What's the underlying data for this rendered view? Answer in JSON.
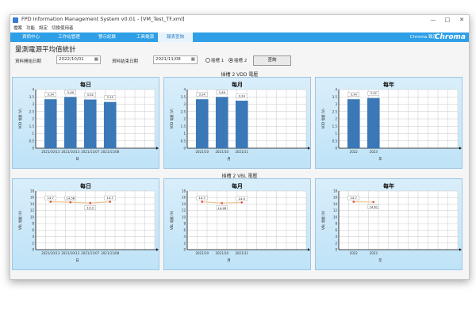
{
  "window": {
    "title": "FPD Information Management System  v0.01  -  [VM_Test_TF.xml]",
    "minimize": "—",
    "maximize": "□",
    "close": "✕"
  },
  "menu": [
    "檔案",
    "功能",
    "設定",
    "切換使用者"
  ],
  "nav": {
    "tabs": [
      "資訊中心",
      "工作站管理",
      "警示紀錄",
      "工具電源",
      "報表查詢"
    ],
    "active_index": 4,
    "brand_small": "Chroma 致茂",
    "brand_logo": "Chroma"
  },
  "page": {
    "title": "量測電源平均值統計",
    "start_label": "資料開始日期",
    "start_value": "2022/10/01",
    "end_label": "資料結束日期",
    "end_value": "2021/11/08",
    "calendar_icon": "calendar-icon",
    "radio1_label": "插槽 1",
    "radio2_label": "插槽 2",
    "selected_radio": 2,
    "query_button": "查詢"
  },
  "sections": {
    "vdd_title": "插槽 2 VDD 電壓",
    "vbl_title": "插槽 2 VBL 電壓"
  },
  "chart_data": [
    {
      "type": "bar",
      "title": "每日",
      "xlabel": "日",
      "ylabel": "VDD 電壓 (V)",
      "categories": [
        "2021/10/13",
        "2021/10/13",
        "2021/11/07",
        "2021/11/08"
      ],
      "values": [
        3.34,
        3.49,
        3.32,
        3.15
      ],
      "data_labels": [
        "3.34",
        "3.49",
        "3.32",
        "3.15"
      ],
      "ylim": [
        0,
        4
      ],
      "yticks": [
        "0",
        "0.5",
        "1",
        "1.5",
        "2",
        "2.5",
        "3",
        "3.5",
        "4"
      ],
      "grid": true
    },
    {
      "type": "bar",
      "title": "每月",
      "xlabel": "月",
      "ylabel": "VDD 電壓 (V)",
      "categories": [
        "2021/10",
        "2021/10",
        "2021/11"
      ],
      "values": [
        3.34,
        3.49,
        3.24
      ],
      "data_labels": [
        "3.34",
        "3.49",
        "3.24"
      ],
      "ylim": [
        0,
        4
      ],
      "yticks": [
        "0",
        "0.5",
        "1",
        "1.5",
        "2",
        "2.5",
        "3",
        "3.5",
        "4"
      ],
      "grid": true
    },
    {
      "type": "bar",
      "title": "每年",
      "xlabel": "年",
      "ylabel": "VDD 電壓 (V)",
      "categories": [
        "2022",
        "2023"
      ],
      "values": [
        3.34,
        3.42
      ],
      "data_labels": [
        "3.34",
        "3.42"
      ],
      "ylim": [
        0,
        4
      ],
      "yticks": [
        "0",
        "0.5",
        "1",
        "1.5",
        "2",
        "2.5",
        "3",
        "3.5",
        "4"
      ],
      "grid": true
    },
    {
      "type": "line",
      "title": "每日",
      "xlabel": "日",
      "ylabel": "VBL 電壓 (V)",
      "categories": [
        "2021/10/13",
        "2021/10/13",
        "2021/11/07",
        "2021/11/08"
      ],
      "values": [
        14.7,
        14.56,
        14.3,
        14.7
      ],
      "data_labels": [
        "14.7",
        "14.56",
        "14.3",
        "14.7"
      ],
      "ylim": [
        0,
        18
      ],
      "yticks": [
        "0",
        "2",
        "4",
        "6",
        "8",
        "10",
        "12",
        "14",
        "16",
        "18"
      ],
      "grid": true
    },
    {
      "type": "line",
      "title": "每月",
      "xlabel": "月",
      "ylabel": "VBL 電壓 (V)",
      "categories": [
        "2021/10",
        "2021/10",
        "2021/11"
      ],
      "values": [
        14.7,
        14.28,
        14.5
      ],
      "data_labels": [
        "14.7",
        "14.28",
        "14.5"
      ],
      "ylim": [
        0,
        18
      ],
      "yticks": [
        "0",
        "2",
        "4",
        "6",
        "8",
        "10",
        "12",
        "14",
        "16",
        "18"
      ],
      "grid": true
    },
    {
      "type": "line",
      "title": "每年",
      "xlabel": "年",
      "ylabel": "VBL 電壓 (V)",
      "categories": [
        "2022",
        "2023"
      ],
      "values": [
        14.7,
        14.61
      ],
      "data_labels": [
        "14.7",
        "14.61"
      ],
      "ylim": [
        0,
        18
      ],
      "yticks": [
        "0",
        "2",
        "4",
        "6",
        "8",
        "10",
        "12",
        "14",
        "16",
        "18"
      ],
      "grid": true
    }
  ],
  "colors": {
    "nav_bg": "#2e9fe6",
    "panel_top": "#d9eefb",
    "panel_bottom": "#bfe3f7",
    "bar": "#3a78b8",
    "line": "#f0c48e",
    "marker": "#d9534f"
  }
}
